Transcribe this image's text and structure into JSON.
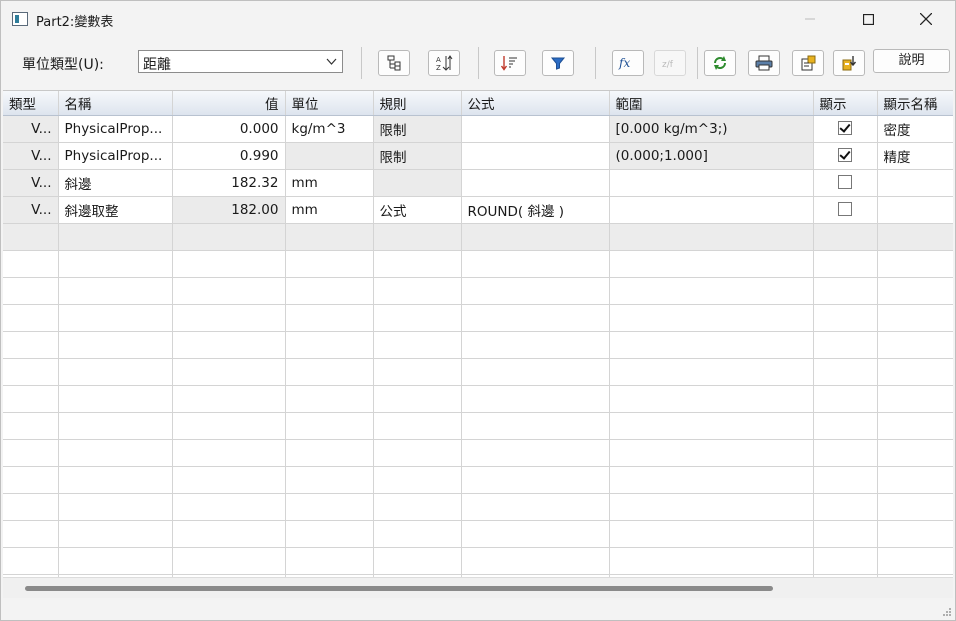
{
  "window": {
    "title": "Part2:變數表"
  },
  "toolbar": {
    "unit_label": "單位類型(U):",
    "unit_value": "距離",
    "help_label": "說明"
  },
  "columns": [
    "類型",
    "名稱",
    "值",
    "單位",
    "規則",
    "公式",
    "範圍",
    "顯示",
    "顯示名稱"
  ],
  "rows": [
    {
      "type": "V...",
      "name": "PhysicalProp...",
      "value": "0.000",
      "unit": "kg/m^3",
      "rule": "限制",
      "formula": "",
      "range": "[0.000 kg/m^3;)",
      "show": true,
      "display_name": "密度"
    },
    {
      "type": "V...",
      "name": "PhysicalProp...",
      "value": "0.990",
      "unit": "",
      "rule": "限制",
      "formula": "",
      "range": "(0.000;1.000]",
      "show": true,
      "display_name": "精度"
    },
    {
      "type": "V...",
      "name": "斜邊",
      "value": "182.32",
      "unit": "mm",
      "rule": "",
      "formula": "",
      "range": "",
      "show": false,
      "display_name": ""
    },
    {
      "type": "V...",
      "name": "斜邊取整",
      "value": "182.00",
      "unit": "mm",
      "rule": "公式",
      "formula": "ROUND( 斜邊 )",
      "range": "",
      "show": false,
      "display_name": ""
    }
  ]
}
